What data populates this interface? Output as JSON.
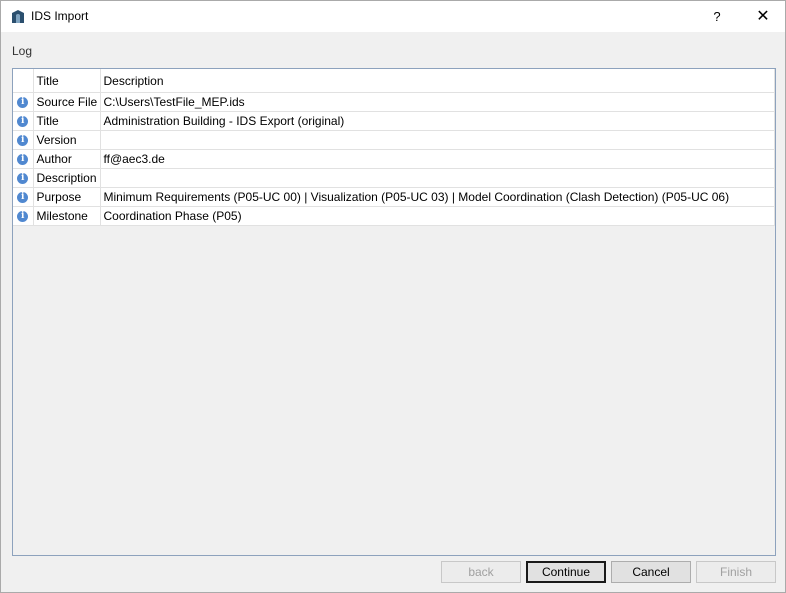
{
  "window": {
    "title": "IDS Import",
    "help_label": "?",
    "close_label": "✕",
    "icon": "ids-logo-icon"
  },
  "log": {
    "label": "Log",
    "columns": [
      "",
      "Title",
      "Description"
    ],
    "rows": [
      {
        "icon": "info-icon",
        "title": "Source File",
        "description": "C:\\Users\\TestFile_MEP.ids"
      },
      {
        "icon": "info-icon",
        "title": "Title",
        "description": "Administration Building - IDS Export (original)"
      },
      {
        "icon": "info-icon",
        "title": "Version",
        "description": ""
      },
      {
        "icon": "info-icon",
        "title": "Author",
        "description": "ff@aec3.de"
      },
      {
        "icon": "info-icon",
        "title": "Description",
        "description": ""
      },
      {
        "icon": "info-icon",
        "title": "Purpose",
        "description": "Minimum Requirements (P05-UC 00) | Visualization (P05-UC 03) | Model Coordination (Clash Detection) (P05-UC 06)"
      },
      {
        "icon": "info-icon",
        "title": "Milestone",
        "description": "Coordination Phase (P05)"
      }
    ]
  },
  "buttons": {
    "back": "back",
    "continue": "Continue",
    "cancel": "Cancel",
    "finish": "Finish"
  },
  "colors": {
    "info_icon": "#5088d0",
    "grid_border": "#8da2bd"
  }
}
